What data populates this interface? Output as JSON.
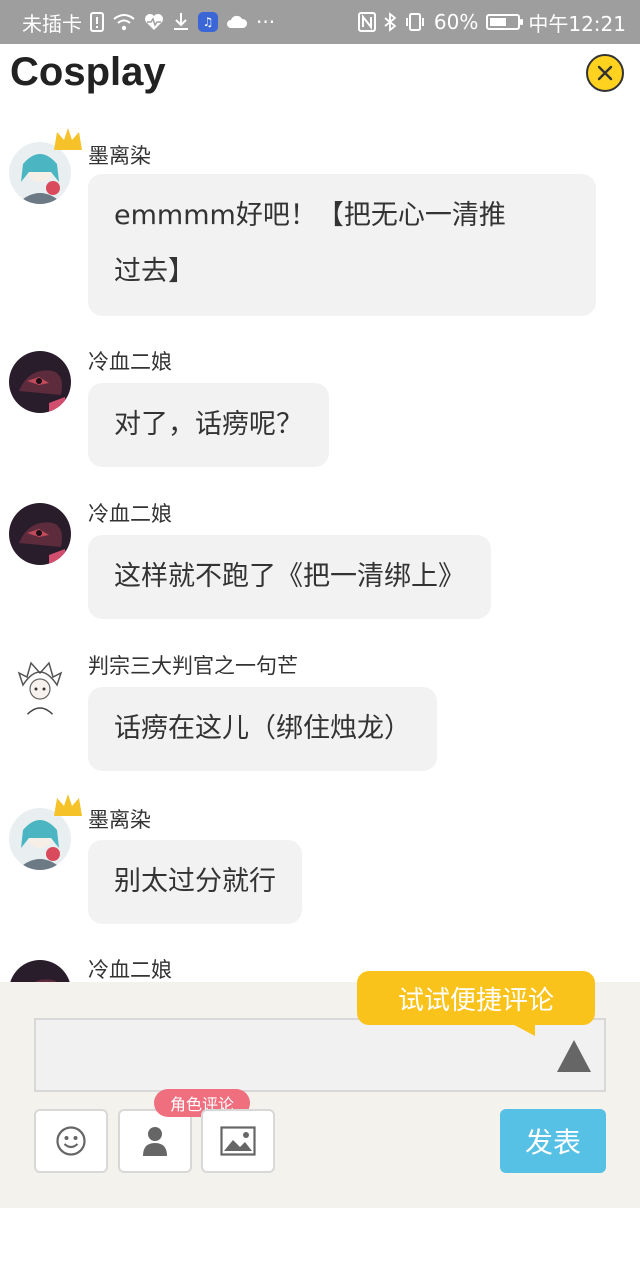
{
  "status_bar": {
    "carrier": "未插卡",
    "dots": "···",
    "battery_percent": "60%",
    "battery_level": 0.6,
    "time": "中午12:21",
    "icons": [
      "sim-alert-icon",
      "wifi-icon",
      "health-icon",
      "download-icon",
      "music-app-icon",
      "cloud-icon",
      "nfc-icon",
      "bluetooth-icon",
      "vibrate-icon",
      "battery-icon"
    ]
  },
  "header": {
    "title": "Cosplay",
    "close_icon": "close-icon"
  },
  "messages": [
    {
      "user": "墨离染",
      "crown": true,
      "avatar": "avatar-molirang",
      "lines": [
        "emmmm好吧！【把无心一清推",
        "过去】"
      ]
    },
    {
      "user": "冷血二娘",
      "crown": false,
      "avatar": "avatar-lengxue",
      "lines": [
        "对了，话痨呢？"
      ]
    },
    {
      "user": "冷血二娘",
      "crown": false,
      "avatar": "avatar-lengxue",
      "lines": [
        "这样就不跑了《把一清绑上》"
      ]
    },
    {
      "user": "判宗三大判官之一句芒",
      "crown": false,
      "avatar": "avatar-jumang",
      "lines": [
        "话痨在这儿（绑住烛龙）"
      ]
    },
    {
      "user": "墨离染",
      "crown": true,
      "avatar": "avatar-molirang",
      "lines": [
        "别太过分就行"
      ]
    },
    {
      "user": "冷血二娘",
      "crown": false,
      "avatar": "avatar-lengxue",
      "lines": []
    }
  ],
  "composer": {
    "tooltip": "试试便捷评论",
    "role_tag": "角色评论",
    "send_label": "发表",
    "input_value": ""
  },
  "colors": {
    "status_bar": "#9e9e9e",
    "bubble": "#f2f2f2",
    "tooltip": "#f9c31c",
    "role_tag": "#ef6f7f",
    "send": "#56c0e5",
    "close": "#ffd21f"
  }
}
